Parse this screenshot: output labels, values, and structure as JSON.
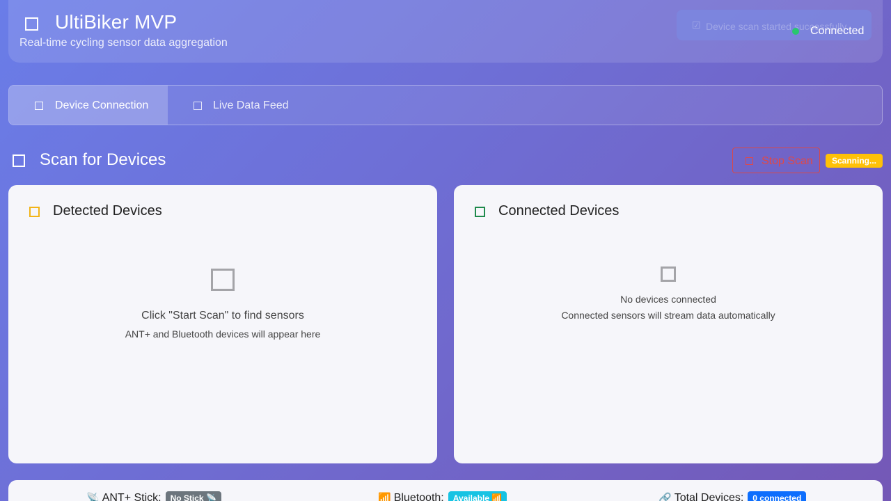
{
  "header": {
    "title": "UltiBiker MVP",
    "subtitle": "Real-time cycling sensor data aggregation",
    "logo_icon": "square-icon",
    "toast": {
      "check": "☑",
      "text": "Device scan started successfully"
    },
    "connection_status": "Connected",
    "connection_color": "#28c76f"
  },
  "tabs": [
    {
      "label": "Device Connection",
      "active": true
    },
    {
      "label": "Live Data Feed",
      "active": false
    }
  ],
  "scan": {
    "title": "Scan for Devices",
    "stop_button": "Stop Scan",
    "status_badge": "Scanning..."
  },
  "detected": {
    "title": "Detected Devices",
    "empty_main": "Click \"Start Scan\" to find sensors",
    "empty_sub": "ANT+ and Bluetooth devices will appear here",
    "icon_color": "#f2b418"
  },
  "connected": {
    "title": "Connected Devices",
    "empty_main": "No devices connected",
    "empty_sub": "Connected sensors will stream data automatically",
    "icon_color": "#1f8a4c"
  },
  "footer": {
    "ant": {
      "glyph": "📡",
      "label": "ANT+ Stick:",
      "badge": "No Stick 📡"
    },
    "bluetooth": {
      "glyph": "📶",
      "label": "Bluetooth:",
      "badge": "Available 📶"
    },
    "total": {
      "glyph": "🔗",
      "label": "Total Devices:",
      "badge": "0 connected"
    }
  }
}
